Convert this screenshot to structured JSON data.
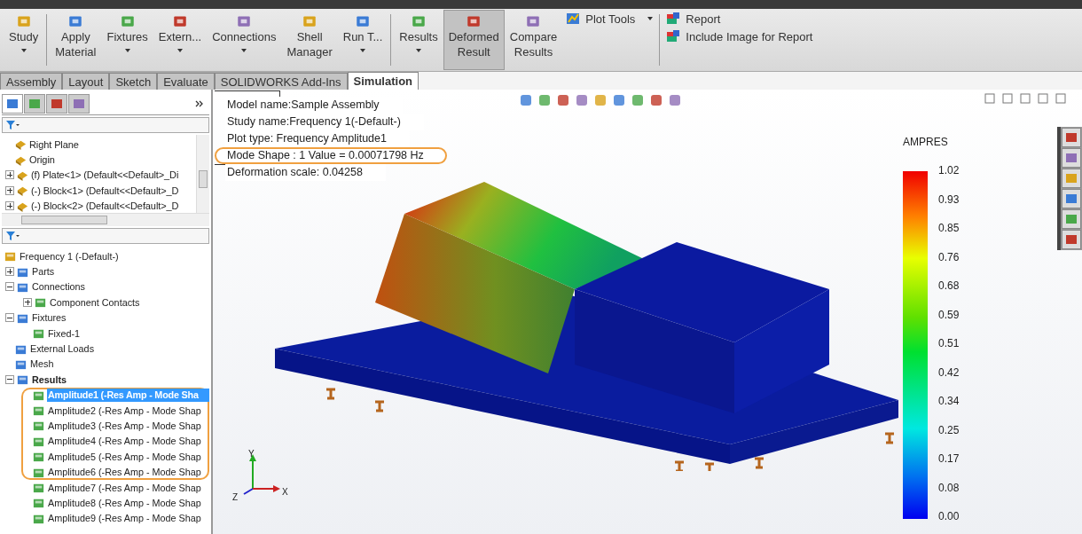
{
  "ribbon": {
    "groups": [
      {
        "buttons": [
          {
            "label": [
              "Study"
            ],
            "caret": true,
            "selected": false
          }
        ]
      },
      {
        "buttons": [
          {
            "label": [
              "Apply",
              "Material"
            ],
            "caret": false,
            "selected": false
          },
          {
            "label": [
              "Fixtures"
            ],
            "caret": true,
            "selected": false
          },
          {
            "label": [
              "Extern..."
            ],
            "caret": true,
            "selected": false
          },
          {
            "label": [
              "Connections"
            ],
            "caret": true,
            "selected": false
          },
          {
            "label": [
              "Shell",
              "Manager"
            ],
            "caret": false,
            "selected": false
          },
          {
            "label": [
              "Run T..."
            ],
            "caret": true,
            "selected": false
          }
        ]
      },
      {
        "buttons": [
          {
            "label": [
              "Results"
            ],
            "caret": true,
            "selected": false
          },
          {
            "label": [
              "Deformed",
              "Result"
            ],
            "caret": false,
            "selected": true
          },
          {
            "label": [
              "Compare",
              "Results"
            ],
            "caret": false,
            "selected": false
          }
        ]
      }
    ],
    "plot_tools": "Plot Tools",
    "links": [
      "Report",
      "Include Image for Report"
    ]
  },
  "panel_tabs": [
    {
      "selected": true
    },
    {
      "selected": false
    },
    {
      "selected": false
    },
    {
      "selected": false
    }
  ],
  "tabs": [
    {
      "label": "Assembly",
      "selected": false
    },
    {
      "label": "Layout",
      "selected": false
    },
    {
      "label": "Sketch",
      "selected": false
    },
    {
      "label": "Evaluate",
      "selected": false
    },
    {
      "label": "SOLIDWORKS Add-Ins",
      "selected": false
    },
    {
      "label": "Simulation",
      "selected": true
    }
  ],
  "feature_tree": [
    {
      "label": "Right Plane"
    },
    {
      "label": "Origin"
    },
    {
      "label": "(f) Plate<1> (Default<<Default>_Di",
      "expanded": false
    },
    {
      "label": "(-) Block<1> (Default<<Default>_D",
      "expanded": false
    },
    {
      "label": "(-) Block<2> (Default<<Default>_D",
      "expanded": false
    }
  ],
  "study_tree": {
    "label": "Frequency 1 (-Default-)",
    "children": [
      {
        "label": "Parts",
        "expanded": false
      },
      {
        "label": "Connections",
        "expanded": true,
        "children": [
          {
            "label": "Component Contacts",
            "expanded": false
          }
        ]
      },
      {
        "label": "Fixtures",
        "expanded": true,
        "children": [
          {
            "label": "Fixed-1"
          }
        ]
      },
      {
        "label": "External Loads"
      },
      {
        "label": "Mesh"
      },
      {
        "label": "Results",
        "expanded": true,
        "bold": true,
        "children": [
          {
            "label": "Amplitude1 (-Res Amp - Mode Sha",
            "selected": true,
            "circled": true
          },
          {
            "label": "Amplitude2 (-Res Amp - Mode Shap",
            "selected": false,
            "circled": true
          },
          {
            "label": "Amplitude3 (-Res Amp - Mode Shap",
            "selected": false,
            "circled": true
          },
          {
            "label": "Amplitude4 (-Res Amp - Mode Shap",
            "selected": false,
            "circled": true
          },
          {
            "label": "Amplitude5 (-Res Amp - Mode Shap",
            "selected": false,
            "circled": true
          },
          {
            "label": "Amplitude6 (-Res Amp - Mode Shap",
            "selected": false,
            "circled": true
          },
          {
            "label": "Amplitude7 (-Res Amp - Mode Shap",
            "selected": false,
            "circled": false
          },
          {
            "label": "Amplitude8 (-Res Amp - Mode Shap",
            "selected": false,
            "circled": false
          },
          {
            "label": "Amplitude9 (-Res Amp - Mode Shap",
            "selected": false,
            "circled": false
          }
        ]
      }
    ]
  },
  "info": [
    {
      "text": "Model name:Sample Assembly",
      "circled": false
    },
    {
      "text": "Study name:Frequency 1(-Default-)",
      "circled": false
    },
    {
      "text": "Plot type: Frequency Amplitude1",
      "circled": false
    },
    {
      "text": "Mode Shape : 1  Value =    0.00071798 Hz",
      "circled": true
    },
    {
      "text": "Deformation scale: 0.04258",
      "circled": false
    }
  ],
  "legend": {
    "title": "AMPRES",
    "labels": [
      "1.02",
      "0.93",
      "0.85",
      "0.76",
      "0.68",
      "0.59",
      "0.51",
      "0.42",
      "0.34",
      "0.25",
      "0.17",
      "0.08",
      "0.00"
    ]
  },
  "triad": {
    "x": "X",
    "y": "Y",
    "z": "Z"
  }
}
